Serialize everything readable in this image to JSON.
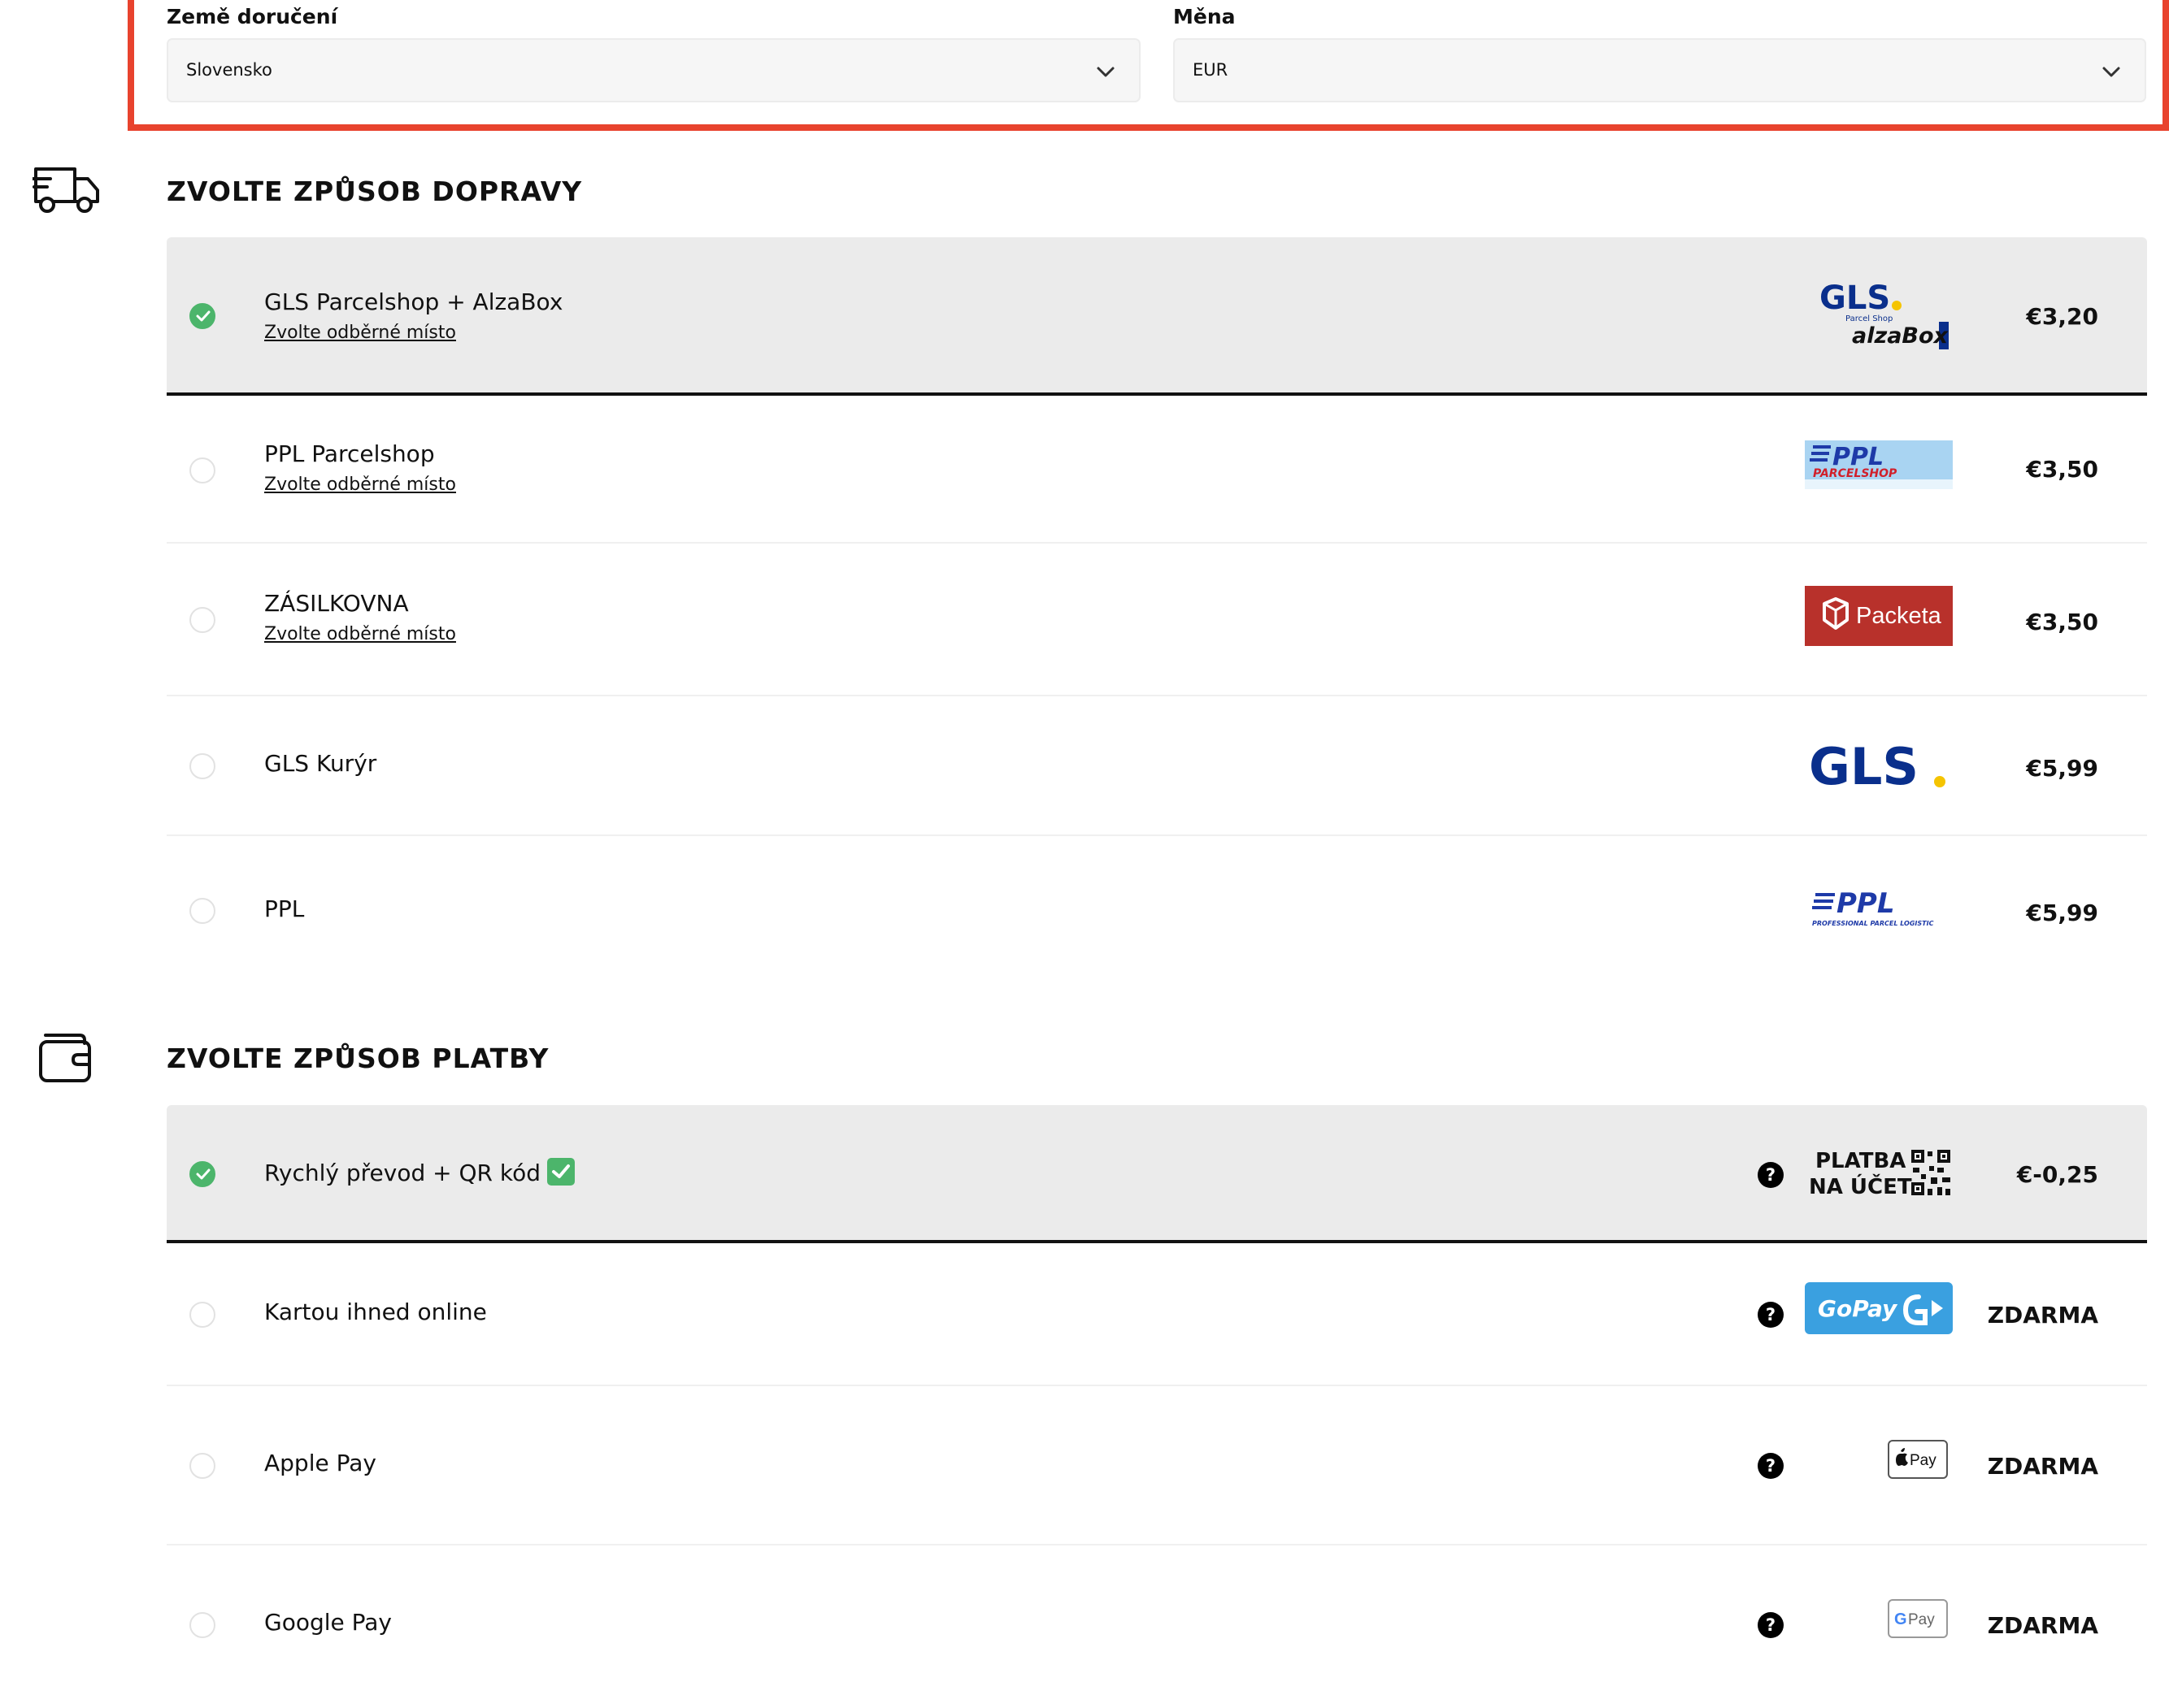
{
  "delivery_settings": {
    "country_label": "Země doručení",
    "country_value": "Slovensko",
    "currency_label": "Měna",
    "currency_value": "EUR"
  },
  "shipping": {
    "title": "ZVOLTE ZPŮSOB DOPRAVY",
    "icon": "truck-icon",
    "options": [
      {
        "name": "GLS Parcelshop + AlzaBox",
        "link": "Zvolte odběrné místo",
        "price": "€3,20",
        "selected": true,
        "logo": {
          "main": "GLS",
          "sub": "Parcel Shop",
          "extra": "alzaBox"
        }
      },
      {
        "name": "PPL Parcelshop",
        "link": "Zvolte odběrné místo",
        "price": "€3,50",
        "selected": false,
        "logo": {
          "main": "PPL",
          "sub": "PARCELSHOP"
        }
      },
      {
        "name": "ZÁSILKOVNA",
        "link": "Zvolte odběrné místo",
        "price": "€3,50",
        "selected": false,
        "logo": {
          "main": "Packeta"
        }
      },
      {
        "name": "GLS Kurýr",
        "price": "€5,99",
        "selected": false,
        "logo": {
          "main": "GLS"
        }
      },
      {
        "name": "PPL",
        "price": "€5,99",
        "selected": false,
        "logo": {
          "main": "PPL",
          "sub": "PROFESSIONAL PARCEL LOGISTIC"
        }
      }
    ]
  },
  "payment": {
    "title": "ZVOLTE ZPŮSOB PLATBY",
    "icon": "wallet-icon",
    "options": [
      {
        "name": "Rychlý převod + QR kód",
        "price": "€-0,25",
        "selected": true,
        "logo": {
          "line1": "PLATBA",
          "line2": "NA ÚČET"
        }
      },
      {
        "name": "Kartou ihned online",
        "price": "ZDARMA",
        "selected": false,
        "logo": {
          "main": "GoPay"
        }
      },
      {
        "name": "Apple Pay",
        "price": "ZDARMA",
        "selected": false,
        "logo": {
          "main": "Pay"
        }
      },
      {
        "name": "Google Pay",
        "price": "ZDARMA",
        "selected": false,
        "logo": {
          "main": "Pay",
          "prefix": "G"
        }
      }
    ],
    "help_glyph": "?"
  },
  "colors": {
    "accent_frame": "#e8432e",
    "check_green": "#4cb56b",
    "gls_blue": "#0a2f8c",
    "gls_yellow": "#f5c400",
    "ppl_blue": "#1e3aa8",
    "ppl_red": "#d11f2a",
    "packeta_red": "#b8312b",
    "gopay_blue": "#3aa0e0"
  }
}
